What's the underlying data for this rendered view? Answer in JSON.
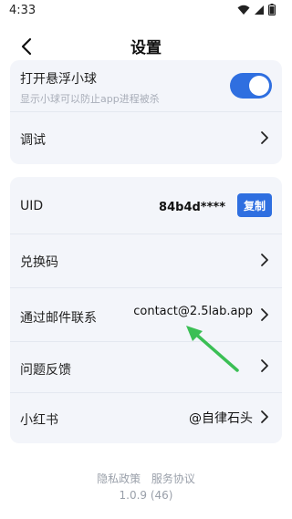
{
  "status_bar": {
    "time": "4:33"
  },
  "header": {
    "title": "设置"
  },
  "settings_group1": {
    "floating_ball_label": "打开悬浮小球",
    "floating_ball_desc": "显示小球可以防止app进程被杀",
    "floating_ball_enabled": true,
    "debug_label": "调试"
  },
  "settings_group2": {
    "uid_label": "UID",
    "uid_value": "84b4d****",
    "copy_label": "复制",
    "redeem_label": "兑换码",
    "email_label": "通过邮件联系",
    "email_value": "contact@2.5lab.app",
    "feedback_label": "问题反馈",
    "xhs_label": "小红书",
    "xhs_value": "@自律石头"
  },
  "footer": {
    "privacy": "隐私政策",
    "terms": "服务协议",
    "version": "1.0.9 (46)"
  },
  "colors": {
    "accent": "#2f6fe0",
    "card_bg": "#f3f5fa",
    "annotation": "#3bbf55"
  }
}
